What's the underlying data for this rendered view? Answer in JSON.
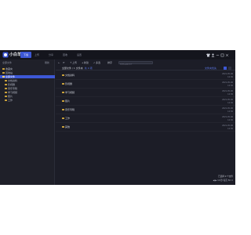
{
  "app": {
    "title": "小白羊"
  },
  "nav": {
    "tabs": [
      "下载",
      "上传",
      "分享",
      "回收",
      "设置"
    ],
    "active": 0
  },
  "titlebar_icons": [
    "shirt-icon",
    "user-icon",
    "minimize-icon",
    "maximize-icon",
    "close-icon"
  ],
  "sidebar": {
    "header": "全部文件",
    "action": "刷新",
    "items": [
      {
        "label": "收藏夹"
      },
      {
        "label": "回收站"
      },
      {
        "label": "全部文件",
        "selected": true
      },
      {
        "label": "文档资料"
      },
      {
        "label": "影视剧"
      },
      {
        "label": "音乐专辑"
      },
      {
        "label": "学习视频"
      },
      {
        "label": "照片"
      },
      {
        "label": "工作"
      }
    ]
  },
  "toolbar": {
    "back": "←",
    "refresh": "⟳",
    "upload": "上传",
    "new": "新建",
    "select": "多选",
    "sort": "排序",
    "search_placeholder": "搜索云盘文件"
  },
  "crumb": {
    "path": "全部文件 / 1 文件夹",
    "sub": "共 9 项",
    "mode": "文件夹优先"
  },
  "files": [
    {
      "name": "文档资料",
      "date": "2021-05-06",
      "size": "12:30"
    },
    {
      "name": "影视剧",
      "date": "2021-05-06",
      "size": "12:30"
    },
    {
      "name": "学习视频",
      "date": "2021-05-06",
      "size": "12:30"
    },
    {
      "name": "照片",
      "date": "2021-05-06",
      "size": "12:30"
    },
    {
      "name": "音乐专辑",
      "date": "2021-05-06",
      "size": "12:30"
    },
    {
      "name": "工作",
      "date": "2021-05-06",
      "size": "12:30"
    },
    {
      "name": "其他",
      "date": "2021-05-06",
      "size": "12:30"
    }
  ],
  "status": {
    "info": "已选择 0 个文件",
    "controls": "◀ ▶  10 秒  每页 50  ⟳"
  },
  "colors": {
    "accent": "#3d58d6",
    "background": "#1c1d27",
    "folder": "#c9a13b"
  }
}
